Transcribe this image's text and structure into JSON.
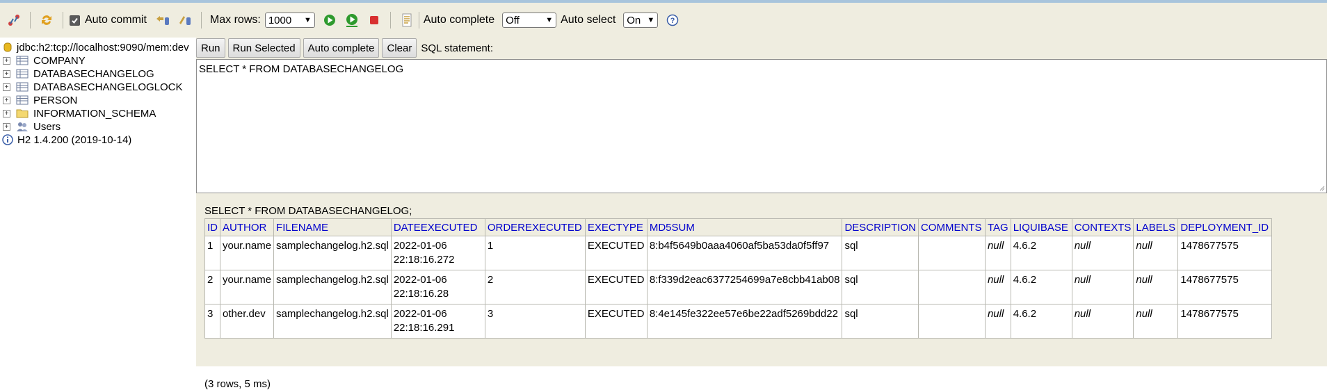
{
  "toolbar": {
    "auto_commit_label": "Auto commit",
    "max_rows_label": "Max rows:",
    "max_rows_value": "1000",
    "auto_complete_label": "Auto complete",
    "auto_complete_value": "Off",
    "auto_select_label": "Auto select",
    "auto_select_value": "On"
  },
  "tree": {
    "connection": "jdbc:h2:tcp://localhost:9090/mem:dev",
    "items": [
      {
        "label": "COMPANY",
        "icon": "table-icon"
      },
      {
        "label": "DATABASECHANGELOG",
        "icon": "table-icon"
      },
      {
        "label": "DATABASECHANGELOGLOCK",
        "icon": "table-icon"
      },
      {
        "label": "PERSON",
        "icon": "table-icon"
      },
      {
        "label": "INFORMATION_SCHEMA",
        "icon": "folder-icon"
      },
      {
        "label": "Users",
        "icon": "users-icon"
      }
    ],
    "version": "H2 1.4.200 (2019-10-14)"
  },
  "editor": {
    "run_label": "Run",
    "run_selected_label": "Run Selected",
    "auto_complete_label": "Auto complete",
    "clear_label": "Clear",
    "sql_statement_label": "SQL statement:",
    "sql_text": "SELECT * FROM DATABASECHANGELOG"
  },
  "result": {
    "query": "SELECT * FROM DATABASECHANGELOG;",
    "columns": [
      "ID",
      "AUTHOR",
      "FILENAME",
      "DATEEXECUTED",
      "ORDEREXECUTED",
      "EXECTYPE",
      "MD5SUM",
      "DESCRIPTION",
      "COMMENTS",
      "TAG",
      "LIQUIBASE",
      "CONTEXTS",
      "LABELS",
      "DEPLOYMENT_ID"
    ],
    "rows": [
      [
        "1",
        "your.name",
        "samplechangelog.h2.sql",
        "2022-01-06 22:18:16.272",
        "1",
        "EXECUTED",
        "8:b4f5649b0aaa4060af5ba53da0f5ff97",
        "sql",
        "",
        "null",
        "4.6.2",
        "null",
        "null",
        "1478677575"
      ],
      [
        "2",
        "your.name",
        "samplechangelog.h2.sql",
        "2022-01-06 22:18:16.28",
        "2",
        "EXECUTED",
        "8:f339d2eac6377254699a7e8cbb41ab08",
        "sql",
        "",
        "null",
        "4.6.2",
        "null",
        "null",
        "1478677575"
      ],
      [
        "3",
        "other.dev",
        "samplechangelog.h2.sql",
        "2022-01-06 22:18:16.291",
        "3",
        "EXECUTED",
        "8:4e145fe322ee57e6be22adf5269bdd22",
        "sql",
        "",
        "null",
        "4.6.2",
        "null",
        "null",
        "1478677575"
      ]
    ],
    "summary": "(3 rows, 5 ms)"
  }
}
